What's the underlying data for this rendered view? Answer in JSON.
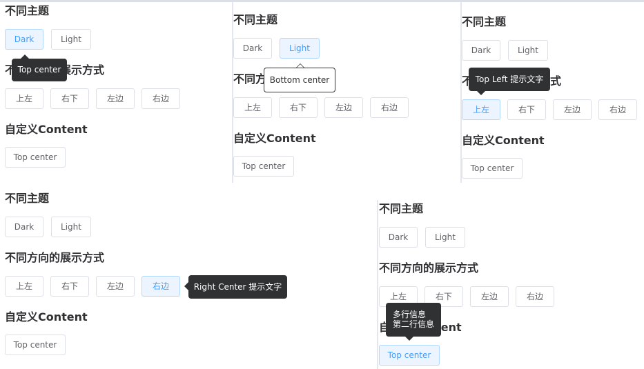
{
  "labels": {
    "themes_heading": "不同主题",
    "directions_heading": "不同方向的展示方式",
    "content_heading": "自定义Content",
    "dark": "Dark",
    "light": "Light",
    "top_left": "上左",
    "right_bottom": "右下",
    "left_side": "左边",
    "right_side": "右边",
    "top_center": "Top center"
  },
  "tooltips": {
    "p1": "Top center",
    "p2": "Bottom center",
    "p3": "Top Left 提示文字",
    "p4": "Right Center 提示文字",
    "p5_line1": "多行信息",
    "p5_line2": "第二行信息"
  },
  "colors": {
    "active_bg": "#ecf5ff",
    "active_text": "#409eff",
    "tooltip_dark": "#303133"
  }
}
